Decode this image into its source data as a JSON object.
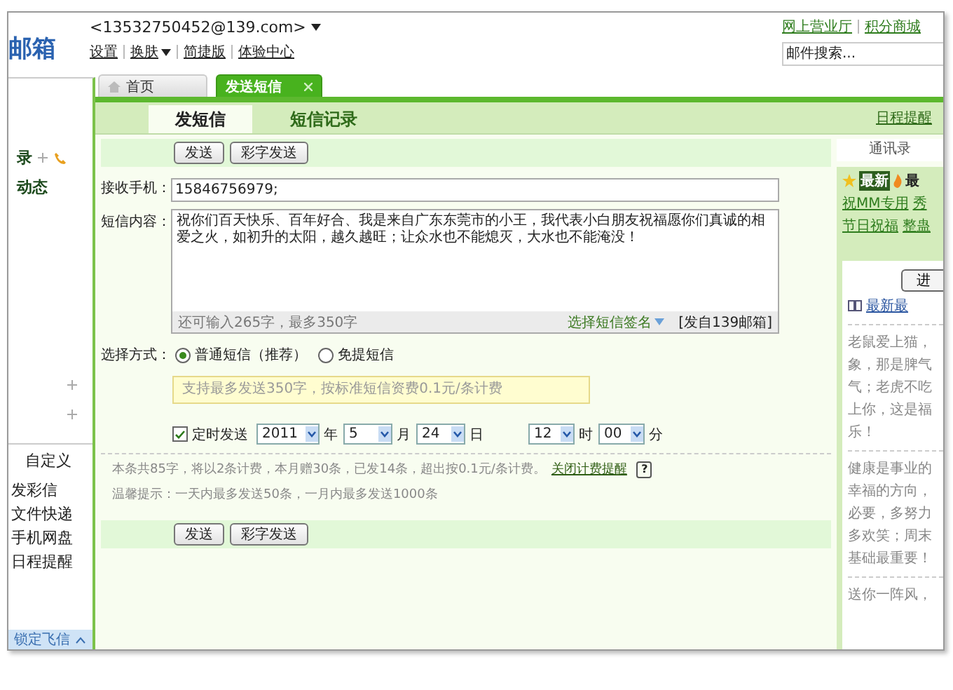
{
  "logo": "邮箱",
  "account": {
    "email": "<13532750452@139.com>"
  },
  "header_links": [
    {
      "label": "设置",
      "dropdown": false
    },
    {
      "label": "换肤",
      "dropdown": true
    },
    {
      "label": "简捷版",
      "dropdown": false
    },
    {
      "label": "体验中心",
      "dropdown": false
    }
  ],
  "top_links": [
    "网上营业厅",
    "积分商城"
  ],
  "search": {
    "placeholder": "邮件搜索..."
  },
  "tabs": [
    {
      "label": "首页",
      "selected": false,
      "closable": false
    },
    {
      "label": "发送短信",
      "selected": true,
      "closable": true
    }
  ],
  "sidebar": {
    "contacts_label": "录",
    "feed_label": "动态",
    "custom_label": "自定义",
    "items": [
      "发彩信",
      "文件快递",
      "手机网盘",
      "日程提醒"
    ],
    "footer": "锁定飞信"
  },
  "subtabs": [
    {
      "label": "发短信",
      "selected": true
    },
    {
      "label": "短信记录",
      "selected": false
    }
  ],
  "schedule_link": "日程提醒",
  "toolbar_buttons": [
    "发送",
    "彩字发送"
  ],
  "form": {
    "recipient_label": "接收手机：",
    "recipient": "15846756979;",
    "content_label": "短信内容：",
    "content": "祝你们百天快乐、百年好合、我是来自广东东莞市的小王，我代表小白朋友祝福愿你们真诚的相爱之火，如初升的太阳，越久越旺；让众水也不能熄灭，大水也不能淹没！",
    "counter": "还可输入265字，最多350字",
    "signature_link": "选择短信签名",
    "signature": "[发自139邮箱]",
    "method_label": "选择方式：",
    "methods": [
      {
        "label": "普通短信（推荐）",
        "selected": true
      },
      {
        "label": "免提短信",
        "selected": false
      }
    ],
    "method_hint": "支持最多发送350字，按标准短信资费0.1元/条计费",
    "schedule": {
      "label": "定时发送",
      "checked": true,
      "year": "2011",
      "year_unit": "年",
      "month": "5",
      "month_unit": "月",
      "day": "24",
      "day_unit": "日",
      "hour": "12",
      "hour_unit": "时",
      "minute": "00",
      "minute_unit": "分"
    },
    "billing": "本条共85字，将以2条计费，本月赠30条，已发14条，超出按0.1元/条计费。",
    "billing_link": "关闭计费提醒",
    "help": "?",
    "tip": "温馨提示：一天内最多发送50条，一月内最多发送1000条"
  },
  "bottom_buttons": [
    "发送",
    "彩字发送"
  ],
  "right_panel": {
    "title": "通讯录",
    "badge": "最新",
    "hot": "最",
    "link_rows": [
      [
        "祝MM专用",
        "秀"
      ],
      [
        "节日祝福",
        "整蛊"
      ]
    ],
    "enter_button": "进",
    "latest_link": "最新最",
    "messages": [
      [
        "老鼠爱上猫，",
        "象，那是脾气",
        "气；老虎不吃",
        "上你，这是福",
        "乐！"
      ],
      [
        "健康是事业的",
        "幸福的方向，",
        "必要，多努力",
        "多欢笑；周末",
        "基础最重要！"
      ],
      [
        "送你一阵风，"
      ]
    ]
  }
}
